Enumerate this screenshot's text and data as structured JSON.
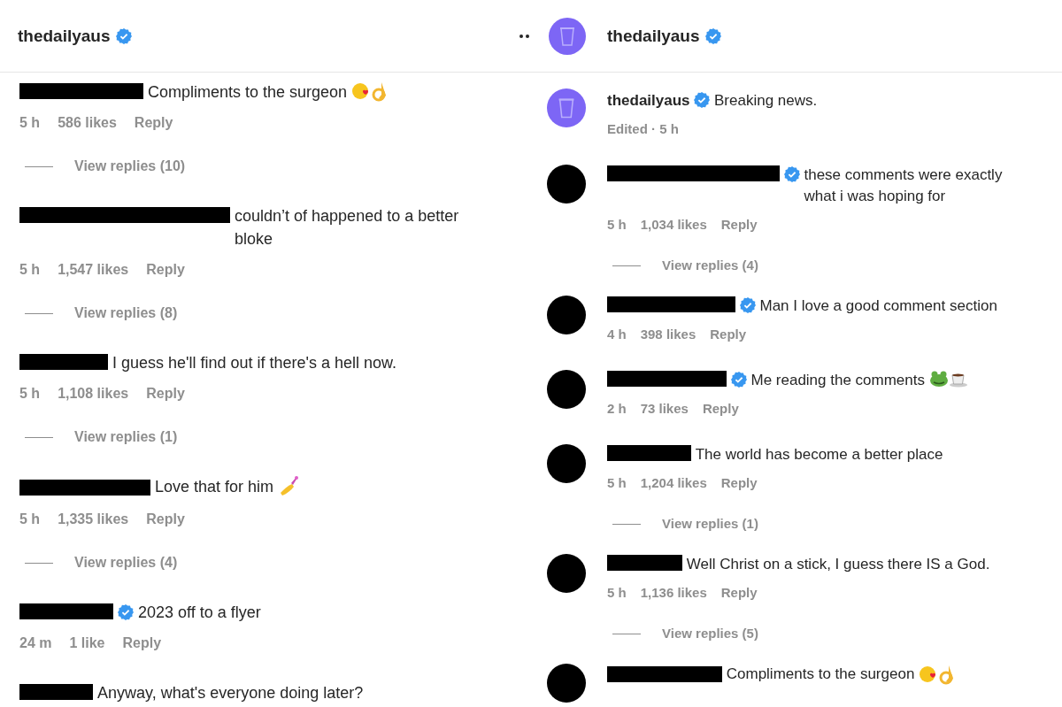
{
  "left_panel": {
    "header": {
      "username": "thedailyaus",
      "verified": true
    },
    "comments": [
      {
        "verified": false,
        "text": "Compliments to the surgeon",
        "emojis": [
          {
            "kind": "kiss"
          },
          {
            "kind": "ok-hand"
          }
        ],
        "time": "5 h",
        "likes": "586 likes",
        "reply": "Reply",
        "view_replies": "View replies (10)"
      },
      {
        "verified": false,
        "text": "couldn’t of happened to a better bloke",
        "time": "5 h",
        "likes": "1,547 likes",
        "reply": "Reply",
        "view_replies": "View replies (8)"
      },
      {
        "verified": false,
        "text": "I guess he'll find out if there's a hell now.",
        "time": "5 h",
        "likes": "1,108 likes",
        "reply": "Reply",
        "view_replies": "View replies (1)"
      },
      {
        "verified": false,
        "text": "Love that for him",
        "emojis": [
          {
            "kind": "nail-polish"
          }
        ],
        "time": "5 h",
        "likes": "1,335 likes",
        "reply": "Reply",
        "view_replies": "View replies (4)"
      },
      {
        "verified": true,
        "text": "2023 off to a flyer",
        "time": "24 m",
        "likes": "1 like",
        "reply": "Reply"
      },
      {
        "verified": false,
        "text": "Anyway, what's everyone doing later?"
      }
    ]
  },
  "right_panel": {
    "header": {
      "username": "thedailyaus",
      "verified": true
    },
    "post": {
      "username": "thedailyaus",
      "verified": true,
      "text": "Breaking news.",
      "meta": "Edited · 5 h"
    },
    "comments": [
      {
        "verified": true,
        "text": "these comments were exactly what i was hoping for",
        "time": "5 h",
        "likes": "1,034 likes",
        "reply": "Reply",
        "view_replies": "View replies (4)"
      },
      {
        "verified": true,
        "text": "Man I love a good comment section",
        "time": "4 h",
        "likes": "398 likes",
        "reply": "Reply"
      },
      {
        "verified": true,
        "text": "Me reading the comments",
        "emojis": [
          {
            "kind": "frog"
          },
          {
            "kind": "coffee"
          }
        ],
        "time": "2 h",
        "likes": "73 likes",
        "reply": "Reply"
      },
      {
        "verified": false,
        "text": "The world has become a better place",
        "time": "5 h",
        "likes": "1,204 likes",
        "reply": "Reply",
        "view_replies": "View replies (1)"
      },
      {
        "verified": false,
        "text": "Well Christ on a stick, I guess there IS a God.",
        "time": "5 h",
        "likes": "1,136 likes",
        "reply": "Reply",
        "view_replies": "View replies (5)"
      },
      {
        "verified": false,
        "text": "Compliments to the surgeon",
        "emojis": [
          {
            "kind": "kiss"
          },
          {
            "kind": "ok-hand"
          }
        ]
      }
    ]
  }
}
